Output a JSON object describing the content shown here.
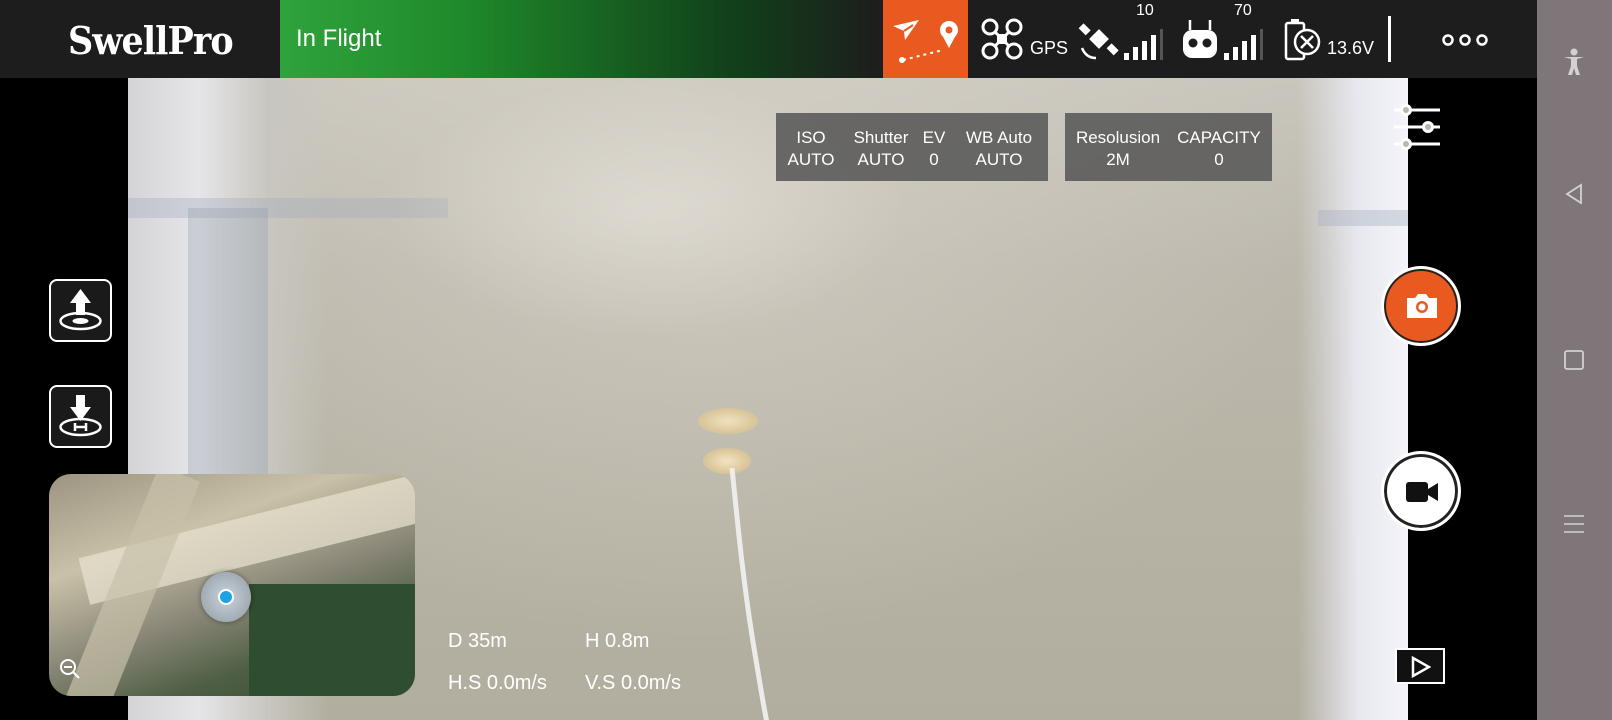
{
  "app": {
    "logo_text": "SwellPro"
  },
  "status": {
    "label": "In Flight"
  },
  "topbar": {
    "gps_label": "GPS",
    "satellite_count": "10",
    "remote_signal": "70",
    "battery_voltage": "13.6V"
  },
  "camera_settings": {
    "iso": {
      "label": "ISO",
      "value": "AUTO"
    },
    "shutter": {
      "label": "Shutter",
      "value": "AUTO"
    },
    "ev": {
      "label": "EV",
      "value": "0"
    },
    "wb": {
      "label": "WB Auto",
      "value": "AUTO"
    }
  },
  "storage": {
    "resolution": {
      "label": "Resolusion",
      "value": "2M"
    },
    "capacity": {
      "label": "CAPACITY",
      "value": "0"
    }
  },
  "telemetry": {
    "distance": "D 35m",
    "height": "H 0.8m",
    "horizontal_speed": "H.S 0.0m/s",
    "vertical_speed": "V.S 0.0m/s"
  },
  "colors": {
    "accent_orange": "#e85a1f",
    "status_green": "#2fa33c",
    "topbar_bg": "#1d1d1d",
    "system_nav_bg": "#7f767a"
  },
  "icons": {
    "mission": "paper-plane-route-icon",
    "drone": "drone-icon",
    "satellite": "satellite-icon",
    "remote": "remote-controller-icon",
    "battery": "battery-icon",
    "more": "more-dots-icon",
    "takeoff": "takeoff-icon",
    "landing": "return-home-icon",
    "settings": "sliders-icon",
    "photo": "camera-icon",
    "video": "video-camera-icon",
    "playback": "play-icon",
    "zoom_out": "zoom-out-icon",
    "accessibility": "accessibility-icon"
  }
}
